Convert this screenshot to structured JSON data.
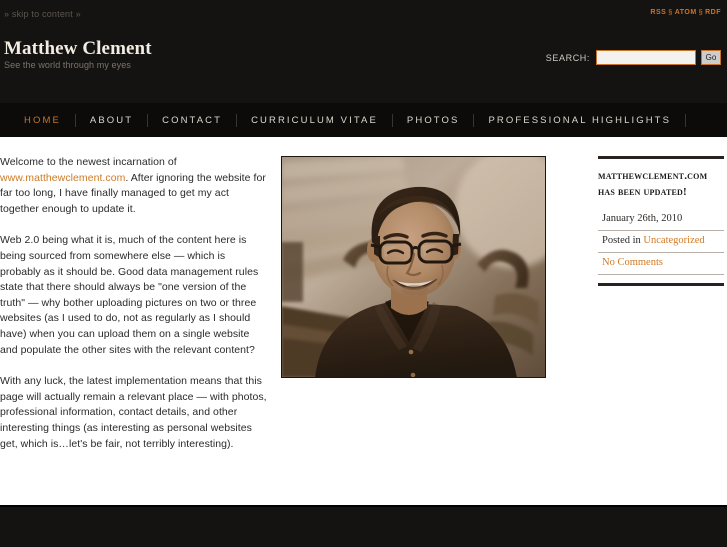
{
  "topbar": {
    "skip_link": "» skip to content »",
    "feeds": {
      "rss": "RSS",
      "atom": "ATOM",
      "rdf": "RDF",
      "separator": "§"
    }
  },
  "masthead": {
    "site_title": "Matthew Clement",
    "tagline": "See the world through my eyes",
    "search": {
      "label": "SEARCH:",
      "value": "",
      "placeholder": "",
      "button_label": "Go"
    }
  },
  "nav": {
    "items": [
      {
        "label": "HOME",
        "active": true
      },
      {
        "label": "ABOUT",
        "active": false
      },
      {
        "label": "CONTACT",
        "active": false
      },
      {
        "label": "CURRICULUM VITAE",
        "active": false
      },
      {
        "label": "PHOTOS",
        "active": false
      },
      {
        "label": "PROFESSIONAL HIGHLIGHTS",
        "active": false
      }
    ]
  },
  "post": {
    "paragraph_1_before_link": "Welcome to the newest incarnation of ",
    "link_text": "www.matthewclement.com",
    "paragraph_1_after_link": ".  After ignoring the website for far too long, I have finally managed to get my act together enough to update it.",
    "paragraph_2": "Web 2.0 being what it is, much of the content here is being sourced from somewhere else — which is probably as it should be.  Good data management rules state that there should always be \"one version of the truth\" — why bother uploading pictures on two or three websites (as I used to do, not as regularly as I should have) when you can upload them on a single website and populate the other sites with the relevant content?",
    "paragraph_3": "With any luck, the latest implementation means that this page will actually remain a relevant place — with photos, professional information, contact details, and other interesting things (as interesting as personal websites get, which is…let's be fair, not terribly interesting).",
    "photo_alt": "Sepia portrait of a smiling man wearing glasses"
  },
  "sidebar": {
    "widget_title": "matthewclement.com has been updated!",
    "date": "January 26th, 2010",
    "posted_in_label": "Posted in ",
    "category": "Uncategorized",
    "comments": "No Comments"
  },
  "colors": {
    "accent_orange": "#c8752a",
    "link_orange": "#d07a24",
    "dark_header": "#151311",
    "nav_bar": "#0c0b0a",
    "body_text": "#2a2a2a"
  }
}
